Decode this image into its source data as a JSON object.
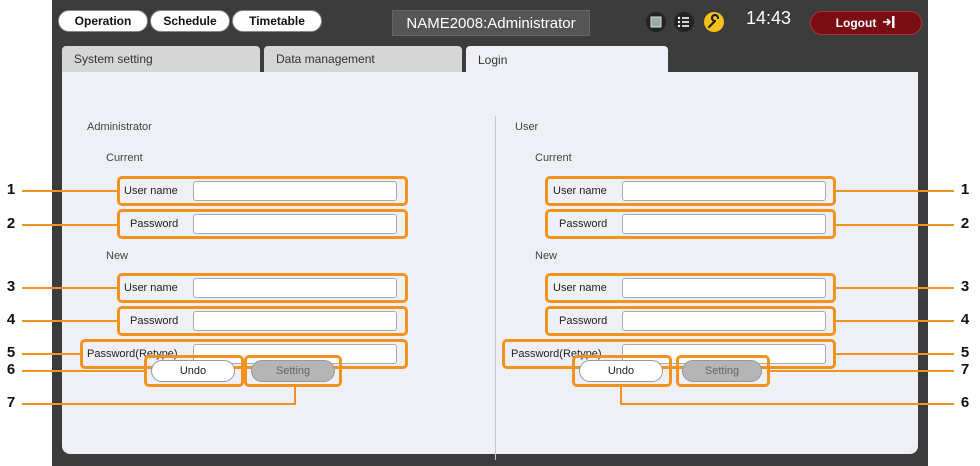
{
  "nav": {
    "operation": "Operation",
    "schedule": "Schedule",
    "timetable": "Timetable"
  },
  "station": "NAME2008:Administrator",
  "clock": "14:43",
  "logout": {
    "label": "Logout"
  },
  "tabs": [
    {
      "label": "System setting"
    },
    {
      "label": "Data management"
    },
    {
      "label": "Login"
    }
  ],
  "admin": {
    "title": "Administrator",
    "current": "Current",
    "new": "New",
    "fields": {
      "username": "User name",
      "password": "Password",
      "retype": "Password(Retype)"
    },
    "values": {
      "cur_user": "",
      "cur_pass": "",
      "new_user": "",
      "new_pass": "",
      "retype": ""
    },
    "undo": "Undo",
    "setting": "Setting"
  },
  "user": {
    "title": "User",
    "current": "Current",
    "new": "New",
    "fields": {
      "username": "User name",
      "password": "Password",
      "retype": "Password(Retype)"
    },
    "values": {
      "cur_user": "",
      "cur_pass": "",
      "new_user": "",
      "new_pass": "",
      "retype": ""
    },
    "undo": "Undo",
    "setting": "Setting"
  },
  "callouts": {
    "n1": "1",
    "n2": "2",
    "n3": "3",
    "n4": "4",
    "n5": "5",
    "n6": "6",
    "n7": "7"
  },
  "colors": {
    "highlight": "#f2921f",
    "logout": "#7a0d12",
    "panel": "#eef0f6",
    "frame": "#3c3c3c"
  }
}
